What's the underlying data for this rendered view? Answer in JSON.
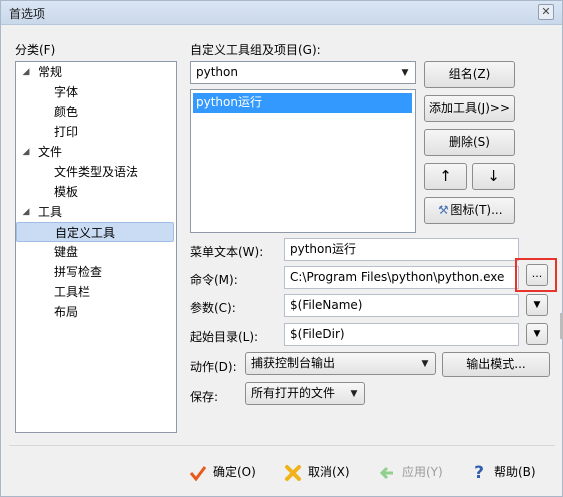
{
  "window": {
    "title": "首选项",
    "close_glyph": "✕"
  },
  "tree": {
    "label": "分类(F)",
    "items": [
      {
        "label": "常规",
        "level": 0,
        "expanded": true
      },
      {
        "label": "字体",
        "level": 1
      },
      {
        "label": "颜色",
        "level": 1
      },
      {
        "label": "打印",
        "level": 1
      },
      {
        "label": "文件",
        "level": 0,
        "expanded": true
      },
      {
        "label": "文件类型及语法",
        "level": 1
      },
      {
        "label": "模板",
        "level": 1
      },
      {
        "label": "工具",
        "level": 0,
        "expanded": true
      },
      {
        "label": "自定义工具",
        "level": 1,
        "selected": true
      },
      {
        "label": "键盘",
        "level": 1
      },
      {
        "label": "拼写检查",
        "level": 1
      },
      {
        "label": "工具栏",
        "level": 1
      },
      {
        "label": "布局",
        "level": 1
      }
    ]
  },
  "custom_tools": {
    "group_label": "自定义工具组及项目(G):",
    "group_value": "python",
    "list_items": [
      "python运行"
    ],
    "buttons": {
      "group_name": "组名(Z)",
      "add_tool": "添加工具(J)>>",
      "delete": "删除(S)",
      "up": "↑",
      "down": "↓",
      "icon": "图标(T)..."
    }
  },
  "form": {
    "menu_text": {
      "label": "菜单文本(W):",
      "value": "python运行"
    },
    "command": {
      "label": "命令(M):",
      "value": "C:\\Program Files\\python\\python.exe",
      "browse": "..."
    },
    "args": {
      "label": "参数(C):",
      "value": "$(FileName)"
    },
    "start_dir": {
      "label": "起始目录(L):",
      "value": "$(FileDir)"
    },
    "action": {
      "label": "动作(D):",
      "value": "捕获控制台输出",
      "output_mode_button": "输出模式..."
    },
    "save": {
      "label": "保存:",
      "value": "所有打开的文件"
    }
  },
  "footer": {
    "ok": "确定(O)",
    "cancel": "取消(X)",
    "apply": "应用(Y)",
    "help": "帮助(B)"
  },
  "colors": {
    "selection": "#3399ff",
    "highlight_box": "#e8332c",
    "ok_icon": "#e85a1b",
    "cancel_icon": "#f1b21a",
    "help_icon": "#2f5fae"
  }
}
